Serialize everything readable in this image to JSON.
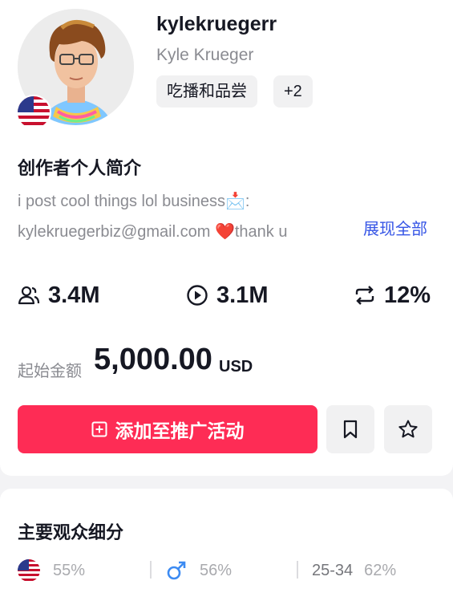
{
  "profile": {
    "username": "kylekruegerr",
    "display_name": "Kyle Krueger",
    "tags": [
      "吃播和品尝",
      "+2"
    ],
    "country_flag": "us-flag-icon"
  },
  "bio": {
    "title": "创作者个人简介",
    "text": "i post cool things lol business📩: kylekruegerbiz@gmail.com ❤️thank u",
    "show_all": "展现全部"
  },
  "stats": {
    "followers": "3.4M",
    "views": "3.1M",
    "engagement": "12%"
  },
  "price": {
    "label": "起始金额",
    "value": "5,000.00",
    "currency": "USD"
  },
  "actions": {
    "add_to_campaign": "添加至推广活动"
  },
  "audience": {
    "title": "主要观众细分",
    "country_pct": "55%",
    "gender_pct": "56%",
    "age_range": "25-34",
    "age_pct": "62%"
  },
  "colors": {
    "accent": "#fe2c55",
    "link": "#3756e6",
    "muted_text": "#8a8b91"
  }
}
